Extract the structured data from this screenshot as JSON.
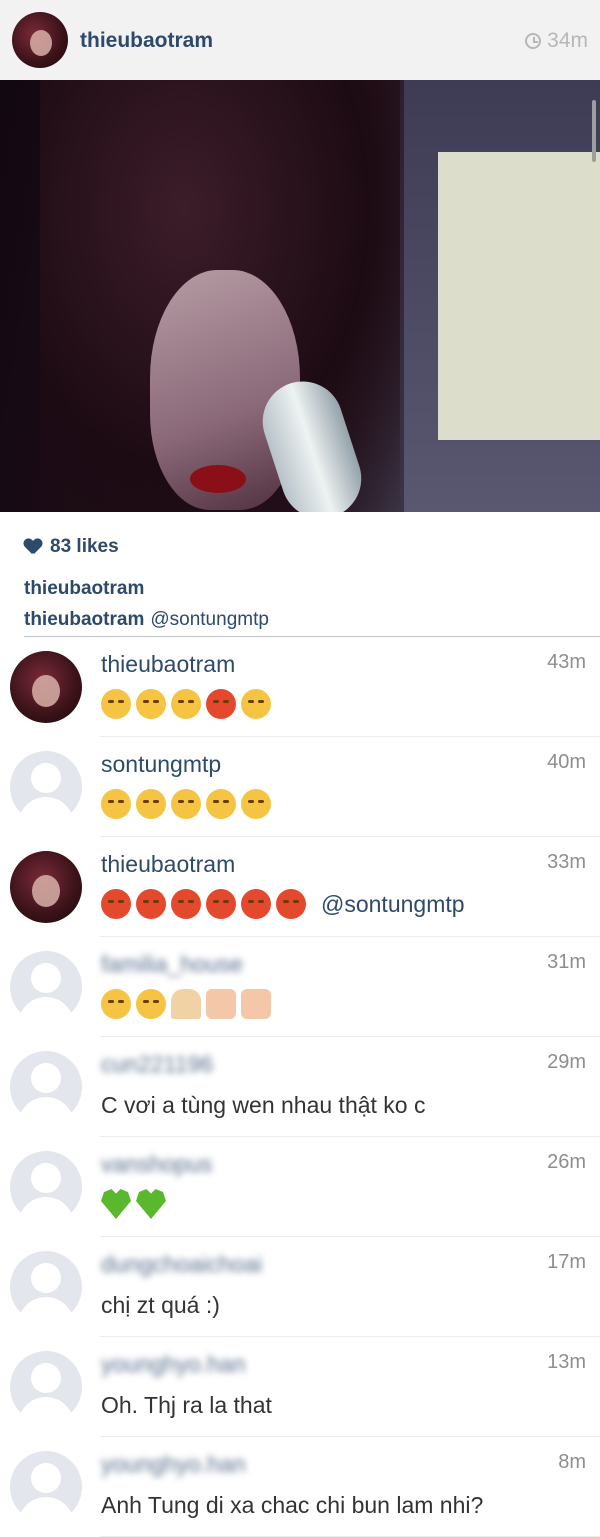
{
  "post": {
    "username": "thieubaotram",
    "time_ago": "34m",
    "likes": "83 likes",
    "caption_user": "thieubaotram",
    "caption_line_user": "thieubaotram",
    "caption_mention": "@sontungmtp"
  },
  "comments": [
    {
      "user": "thieubaotram",
      "time": "43m",
      "avatar": "photo",
      "emojis": [
        "sad",
        "sad",
        "unam",
        "angry",
        "conf"
      ],
      "text": "",
      "mention": ""
    },
    {
      "user": "sontungmtp",
      "time": "40m",
      "avatar": "default",
      "emojis": [
        "sad",
        "sad",
        "sad",
        "unam",
        "unam"
      ],
      "text": "",
      "mention": ""
    },
    {
      "user": "thieubaotram",
      "time": "33m",
      "avatar": "photo",
      "emojis": [
        "angry",
        "angry",
        "angry",
        "angry",
        "angry",
        "angry"
      ],
      "text": "",
      "mention": "@sontungmtp"
    },
    {
      "user": "familia_house",
      "time": "31m",
      "avatar": "default",
      "blurred": true,
      "emojis": [
        "tongue",
        "kiss",
        "pray",
        "couple",
        "couple"
      ],
      "text": "",
      "mention": ""
    },
    {
      "user": "cun221196",
      "time": "29m",
      "avatar": "default",
      "blurred": true,
      "emojis": [],
      "text": "C vơi a tùng wen nhau thật ko c",
      "mention": ""
    },
    {
      "user": "vanshopus",
      "time": "26m",
      "avatar": "default",
      "blurred": true,
      "emojis": [
        "green",
        "green"
      ],
      "text": "",
      "mention": ""
    },
    {
      "user": "dungchoaichoai",
      "time": "17m",
      "avatar": "default",
      "blurred": true,
      "emojis": [],
      "text": "chị zt quá :)",
      "mention": ""
    },
    {
      "user": "younghyo.han",
      "time": "13m",
      "avatar": "default",
      "blurred": true,
      "emojis": [],
      "text": "Oh. Thj ra la that",
      "mention": ""
    },
    {
      "user": "younghyo.han",
      "time": "8m",
      "avatar": "default",
      "blurred": true,
      "emojis": [],
      "text": "Anh Tung di xa chac chi bun lam nhi?",
      "mention": ""
    }
  ],
  "icons": {
    "clock": "clock-icon",
    "heart": "heart-icon"
  },
  "colors": {
    "username": "#2d4a6b",
    "timestamp": "#8e8e8e",
    "header_bg": "#f2f2f2"
  }
}
